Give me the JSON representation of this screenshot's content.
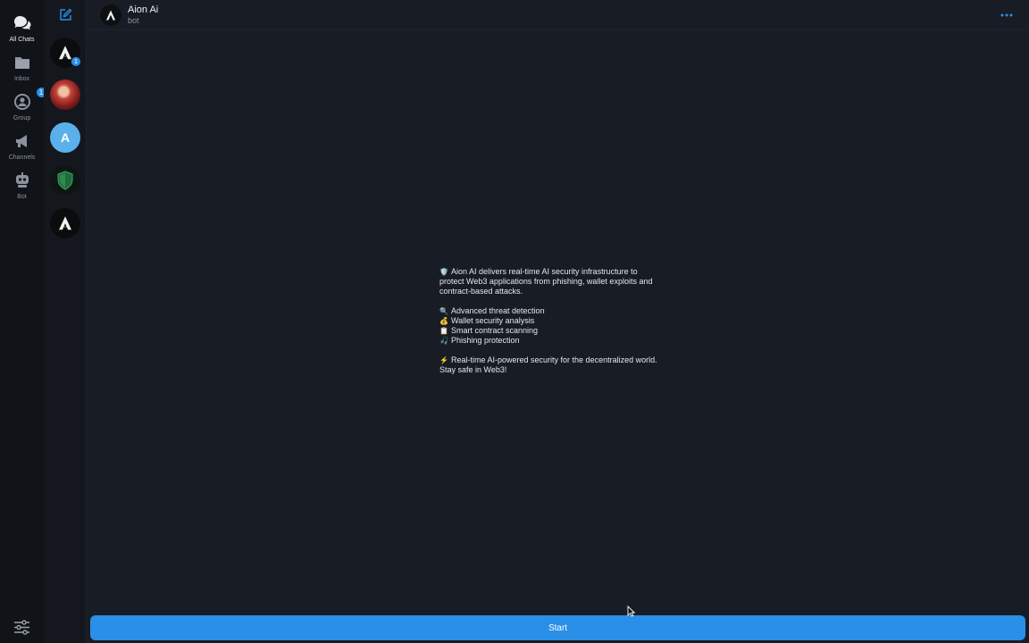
{
  "rail": {
    "items": [
      {
        "label": "All Chats",
        "icon": "chat-bubbles-icon",
        "active": true
      },
      {
        "label": "Inbox",
        "icon": "folder-icon",
        "active": false
      },
      {
        "label": "Group",
        "icon": "group-icon",
        "active": false,
        "badge": "1"
      },
      {
        "label": "Channels",
        "icon": "megaphone-icon",
        "active": false
      },
      {
        "label": "Bot",
        "icon": "robot-icon",
        "active": false
      }
    ],
    "settings_icon": "sliders-icon"
  },
  "chatlist": {
    "compose_icon": "compose-icon",
    "avatars": [
      {
        "name": "aion-ai-chat",
        "initial": "",
        "badge": "1"
      },
      {
        "name": "red-character-chat",
        "initial": ""
      },
      {
        "name": "letter-a-chat",
        "initial": "A"
      },
      {
        "name": "shield-chat",
        "initial": ""
      },
      {
        "name": "aion-ai-chat-2",
        "initial": ""
      }
    ]
  },
  "header": {
    "title": "Aion Ai",
    "subtitle": "bot",
    "more_icon": "more-dots-icon"
  },
  "intro": {
    "line1": "Aion AI delivers real-time AI security infrastructure to",
    "line2": "protect Web3 applications from phishing, wallet exploits and",
    "line3": "contract-based attacks.",
    "features": [
      {
        "emoji": "🔍",
        "text": "Advanced threat detection"
      },
      {
        "emoji": "💰",
        "text": "Wallet security analysis"
      },
      {
        "emoji": "📋",
        "text": "Smart contract scanning"
      },
      {
        "emoji": "🎣",
        "text": "Phishing protection"
      }
    ],
    "footer1": "Real-time AI-powered security for the decentralized world.",
    "footer2": "Stay safe in Web3!",
    "shield_emoji": "🛡️",
    "bolt_emoji": "⚡"
  },
  "start_button": {
    "label": "Start"
  },
  "colors": {
    "accent": "#2a8fe6",
    "background": "#181d25",
    "rail": "#101318"
  }
}
